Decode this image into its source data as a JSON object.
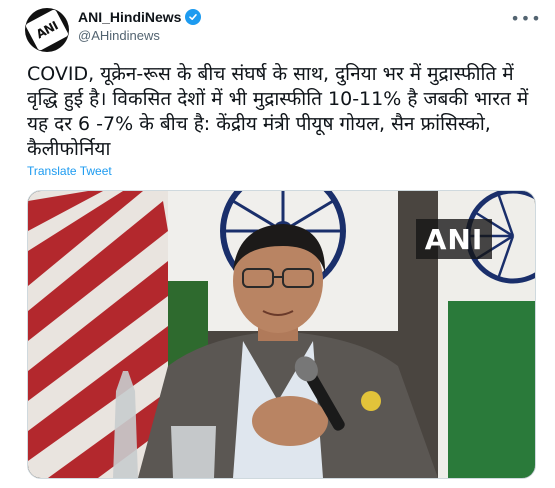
{
  "tweet": {
    "avatar_text": "ANI",
    "display_name": "ANI_HindiNews",
    "handle": "@AHindinews",
    "more_label": "•••",
    "text": "COVID, यूक्रेन-रूस के बीच संघर्ष के साथ, दुनिया भर में मुद्रास्फीति में वृद्धि हुई है। विकसित देशों में भी मुद्रास्फीति 10-11% है जबकी भारत में यह दर 6 -7% के बीच है: केंद्रीय मंत्री पीयूष गोयल, सैन फ्रांसिस्को, कैलीफोर्निया",
    "translate_label": "Translate Tweet",
    "media_watermark": "ANI"
  },
  "colors": {
    "link_blue": "#1d9bf0",
    "secondary_text": "#536471",
    "primary_text": "#0f1419"
  },
  "icons": {
    "verified": "verified-badge-icon",
    "more": "more-horizontal-icon"
  }
}
